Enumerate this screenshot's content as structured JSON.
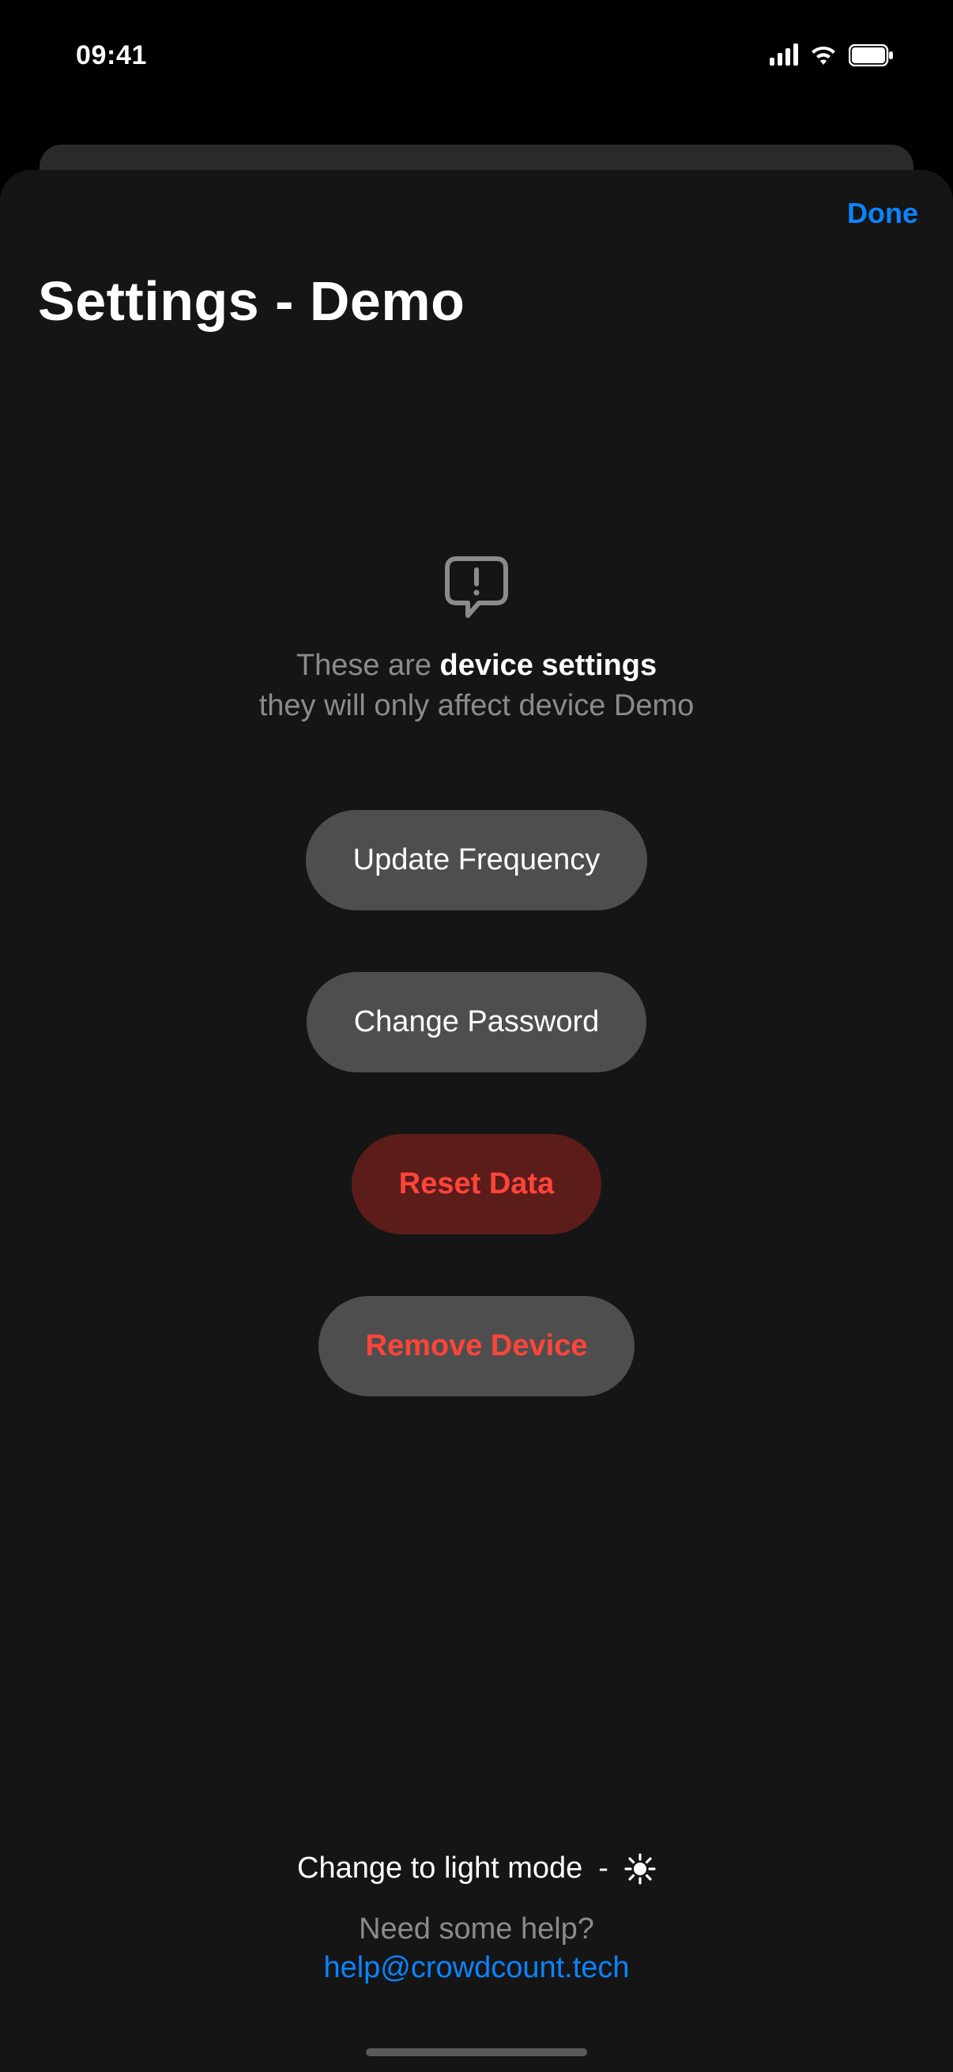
{
  "statusBar": {
    "time": "09:41"
  },
  "sheet": {
    "doneLabel": "Done",
    "title": "Settings - Demo"
  },
  "info": {
    "prefix": "These are ",
    "strong": "device settings",
    "line2": "they will only affect device Demo"
  },
  "buttons": {
    "updateFrequency": "Update Frequency",
    "changePassword": "Change Password",
    "resetData": "Reset Data",
    "removeDevice": "Remove Device"
  },
  "footer": {
    "themeToggle": "Change to light mode",
    "themeSeparator": "-",
    "helpPrompt": "Need some help?",
    "helpEmail": "help@crowdcount.tech"
  }
}
